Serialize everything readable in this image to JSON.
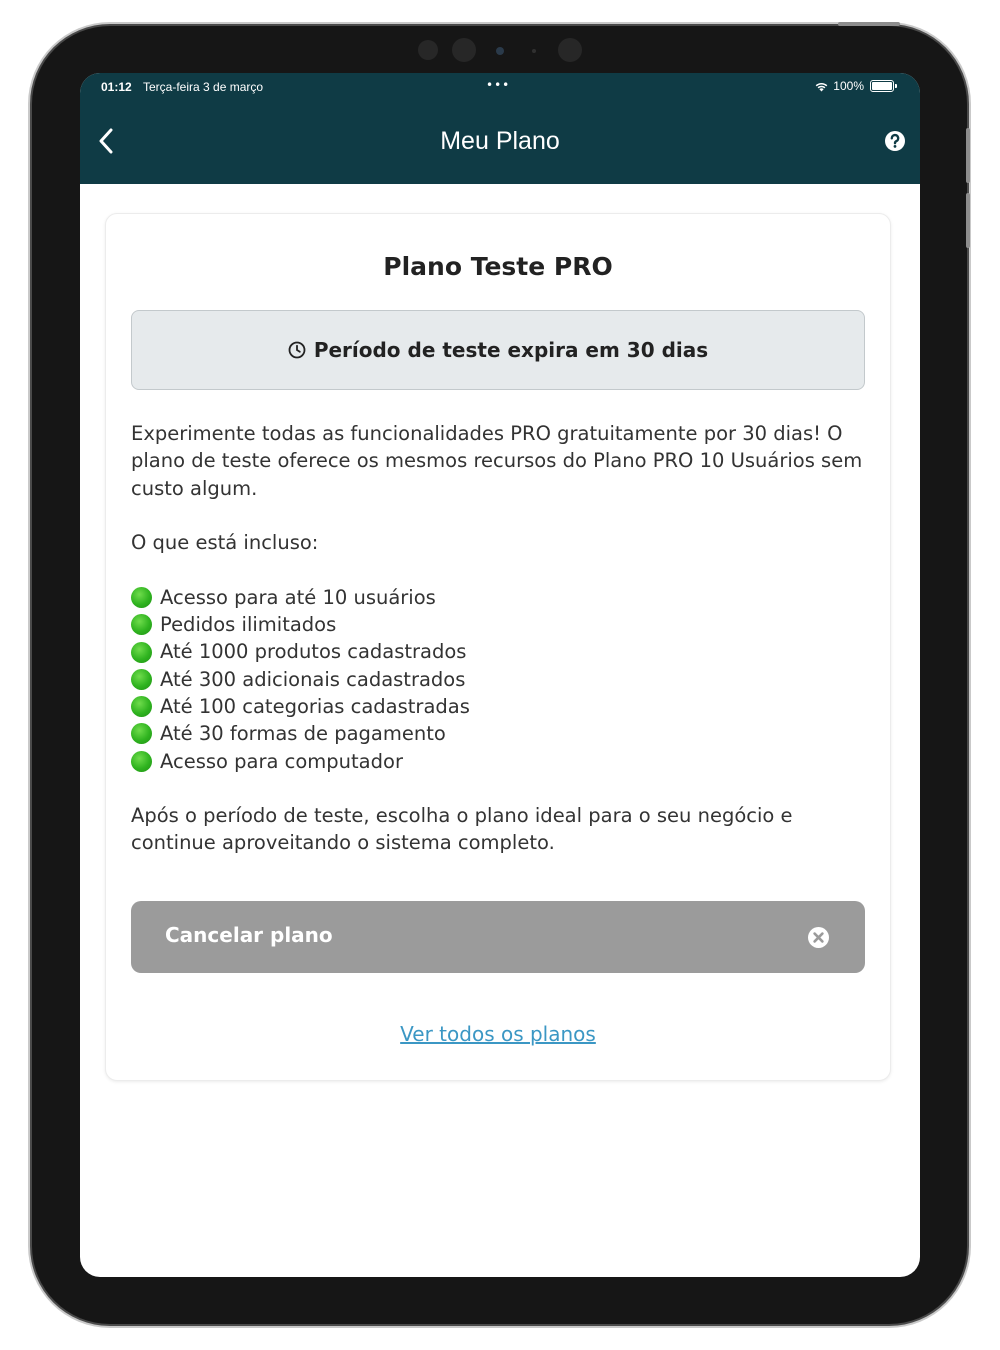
{
  "status_bar": {
    "time": "01:12",
    "date": "Terça-feira 3 de março",
    "dots": "•••",
    "battery": "100%"
  },
  "header": {
    "title": "Meu Plano",
    "back_icon": "chevron-left-icon",
    "help_icon": "question-circle-icon",
    "background_color": "#0f3b45"
  },
  "plan": {
    "name": "Plano Teste PRO",
    "trial_icon": "clock-icon",
    "trial_notice": "Período de teste expira em 30 dias",
    "description": "Experimente todas as funcionalidades PRO gratuitamente por 30 dias! O plano de teste oferece os mesmos recursos do Plano PRO 10 Usuários sem custo algum.",
    "included_heading": "O que está incluso:",
    "features": [
      "Acesso para até 10 usuários",
      "Pedidos ilimitados",
      "Até 1000 produtos cadastrados",
      "Até 300 adicionais cadastrados",
      "Até 100 categorias cadastradas",
      "Até 30 formas de pagamento",
      "Acesso para computador"
    ],
    "footer_text": "Após o período de teste, escolha o plano ideal para o seu negócio e continue aproveitando o sistema completo."
  },
  "actions": {
    "cancel_label": "Cancelar plano",
    "cancel_icon": "close-circle-icon",
    "all_plans_link": "Ver todos os planos",
    "link_color": "#3b97c4",
    "cancel_color": "#9b9b9b"
  }
}
